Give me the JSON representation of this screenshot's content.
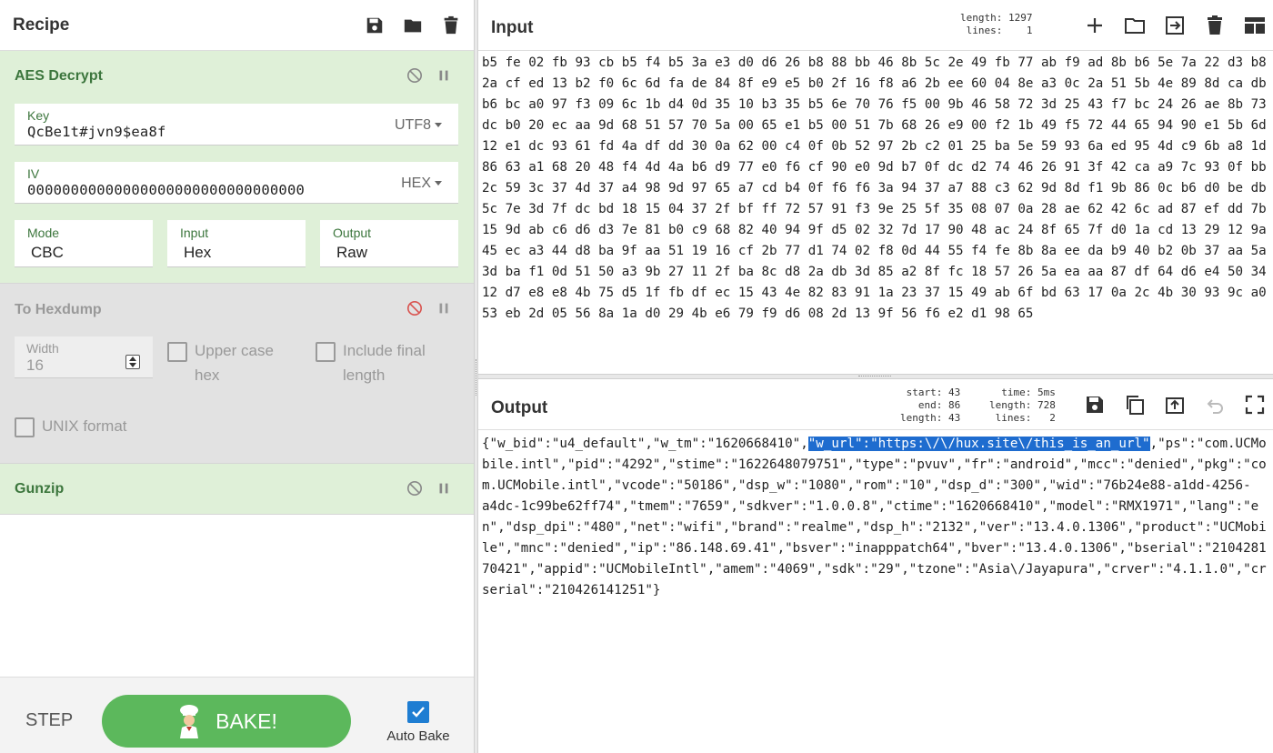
{
  "recipe": {
    "title": "Recipe",
    "icons": [
      "save-icon",
      "folder-icon",
      "trash-icon"
    ]
  },
  "operations": {
    "aes": {
      "title": "AES Decrypt",
      "key_label": "Key",
      "key_value": "QcBe1t#jvn9$ea8f",
      "key_encoding": "UTF8",
      "iv_label": "IV",
      "iv_value": "00000000000000000000000000000000",
      "iv_encoding": "HEX",
      "mode_label": "Mode",
      "mode_value": "CBC",
      "input_label": "Input",
      "input_value": "Hex",
      "output_label": "Output",
      "output_value": "Raw"
    },
    "hexdump": {
      "title": "To Hexdump",
      "width_label": "Width",
      "width_value": "16",
      "uppercase_label": "Upper case\nhex",
      "include_label": "Include final\nlength",
      "unix_label": "UNIX format"
    },
    "gunzip": {
      "title": "Gunzip"
    }
  },
  "controls": {
    "step_label": "STEP",
    "bake_label": "BAKE!",
    "autobake_label": "Auto Bake",
    "autobake_checked": true
  },
  "input": {
    "title": "Input",
    "stats": "length: 1297\n lines:    1",
    "text": "b5 fe 02 fb 93 cb b5 f4 b5 3a e3 d0 d6 26 b8 88 bb 46 8b 5c 2e 49 fb 77 ab f9 ad 8b b6 5e 7a 22 d3 b8 2a cf ed 13 b2 f0 6c 6d fa de 84 8f e9 e5 b0 2f 16 f8 a6 2b ee 60 04 8e a3 0c 2a 51 5b 4e 89 8d ca db b6 bc a0 97 f3 09 6c 1b d4 0d 35 10 b3 35 b5 6e 70 76 f5 00 9b 46 58 72 3d 25 43 f7 bc 24 26 ae 8b 73 dc b0 20 ec aa 9d 68 51 57 70 5a 00 65 e1 b5 00 51 7b 68 26 e9 00 f2 1b 49 f5 72 44 65 94 90 e1 5b 6d 12 e1 dc 93 61 fd 4a df dd 30 0a 62 00 c4 0f 0b 52 97 2b c2 01 25 ba 5e 59 93 6a ed 95 4d c9 6b a8 1d 86 63 a1 68 20 48 f4 4d 4a b6 d9 77 e0 f6 cf 90 e0 9d b7 0f dc d2 74 46 26 91 3f 42 ca a9 7c 93 0f bb 2c 59 3c 37 4d 37 a4 98 9d 97 65 a7 cd b4 0f f6 f6 3a 94 37 a7 88 c3 62 9d 8d f1 9b 86 0c b6 d0 be db 5c 7e 3d 7f dc bd 18 15 04 37 2f bf ff 72 57 91 f3 9e 25 5f 35 08 07 0a 28 ae 62 42 6c ad 87 ef dd 7b 15 9d ab c6 d6 d3 7e 81 b0 c9 68 82 40 94 9f d5 02 32 7d 17 90 48 ac 24 8f 65 7f d0 1a cd 13 29 12 9a 45 ec a3 44 d8 ba 9f aa 51 19 16 cf 2b 77 d1 74 02 f8 0d 44 55 f4 fe 8b 8a ee da b9 40 b2 0b 37 aa 5a 3d ba f1 0d 51 50 a3 9b 27 11 2f ba 8c d8 2a db 3d 85 a2 8f fc 18 57 26 5a ea aa 87 df 64 d6 e4 50 34 12 d7 e8 e8 4b 75 d5 1f fb df ec 15 43 4e 82 83 91 1a 23 37 15 49 ab 6f bd 63 17 0a 2c 4b 30 93 9c a0 53 eb 2d 05 56 8a 1a d0 29 4b e6 79 f9 d6 08 2d 13 9f 56 f6 e2 d1 98 65"
  },
  "output": {
    "title": "Output",
    "stats_left": "start: 43\n  end: 86\nlength: 43",
    "stats_right": "time: 5ms\nlength: 728\nlines:   2",
    "text_before": "{\"w_bid\":\"u4_default\",\"w_tm\":\"1620668410\",",
    "text_selected": "\"w_url\":\"https:\\/\\/hux.site\\/this_is_an_url\"",
    "text_after": ",\"ps\":\"com.UCMobile.intl\",\"pid\":\"4292\",\"stime\":\"1622648079751\",\"type\":\"pvuv\",\"fr\":\"android\",\"mcc\":\"denied\",\"pkg\":\"com.UCMobile.intl\",\"vcode\":\"50186\",\"dsp_w\":\"1080\",\"rom\":\"10\",\"dsp_d\":\"300\",\"wid\":\"76b24e88-a1dd-4256-\na4dc-1c99be62ff74\",\"tmem\":\"7659\",\"sdkver\":\"1.0.0.8\",\"ctime\":\"1620668410\",\"model\":\"RMX1971\",\"lang\":\"en\",\"dsp_dpi\":\"480\",\"net\":\"wifi\",\"brand\":\"realme\",\"dsp_h\":\"2132\",\"ver\":\"13.4.0.1306\",\"product\":\"UCMobile\",\"mnc\":\"denied\",\"ip\":\"86.148.69.41\",\"bsver\":\"inapppatch64\",\"bver\":\"13.4.0.1306\",\"bserial\":\"210428170421\",\"appid\":\"UCMobileIntl\",\"amem\":\"4069\",\"sdk\":\"29\",\"tzone\":\"Asia\\/Jayapura\",\"crver\":\"4.1.1.0\",\"crserial\":\"210426141251\"}"
  },
  "colors": {
    "enabled_bg": "#dff0d8",
    "disabled_bg": "#e2e2e2",
    "enabled_text": "#3c763d",
    "bake_green": "#5cb85c",
    "selection": "#1e6ccf",
    "disable_icon_red": "#d9534f"
  }
}
